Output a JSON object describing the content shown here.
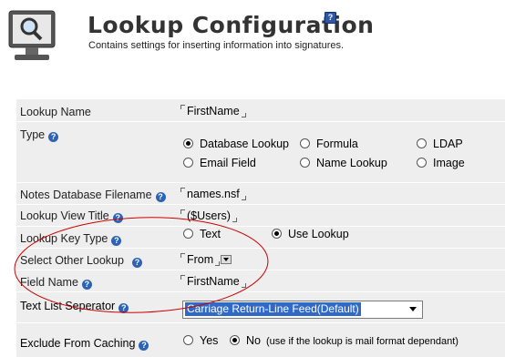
{
  "header": {
    "title": "Lookup Configuration",
    "subtitle": "Contains settings for inserting information into signatures.",
    "help_glyph": "?"
  },
  "form": {
    "lookup_name": {
      "label": "Lookup Name",
      "value": "FirstName"
    },
    "type": {
      "label": "Type",
      "options": [
        "Database Lookup",
        "Formula",
        "LDAP",
        "Email Field",
        "Name Lookup",
        "Image"
      ],
      "selected": "Database Lookup"
    },
    "notes_db": {
      "label": "Notes Database Filename",
      "value": "names.nsf"
    },
    "view_title": {
      "label": "Lookup View Title",
      "value": "($Users)"
    },
    "key_type": {
      "label": "Lookup Key Type",
      "options": [
        "Text",
        "Use Lookup"
      ],
      "selected": "Use Lookup"
    },
    "other_lookup": {
      "label": "Select Other Lookup",
      "value": "From"
    },
    "field_name": {
      "label": "Field Name",
      "value": "FirstName"
    },
    "separator": {
      "label": "Text List Seperator",
      "value": "Carriage Return-Line Feed(Default)"
    },
    "caching": {
      "label": "Exclude From Caching",
      "options": [
        "Yes",
        "No"
      ],
      "selected": "No",
      "note": "(use if the lookup is mail format dependant)"
    }
  },
  "colors": {
    "row_bg": "#eeeeee",
    "help_icon": "#2d63b4",
    "selection": "#3169c6",
    "annotation": "#cc0000"
  },
  "icons": [
    "monitor-search-icon",
    "help-icon",
    "radio-icon",
    "dropdown-arrow-icon"
  ]
}
